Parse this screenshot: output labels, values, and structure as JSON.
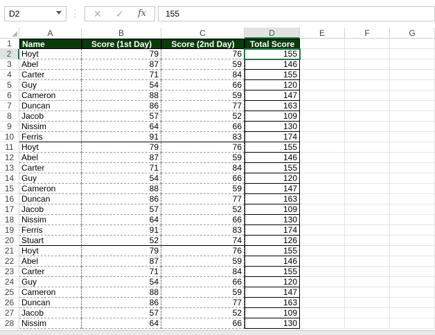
{
  "formula_bar": {
    "name_box": "D2",
    "value": "155",
    "cancel_icon": "✕",
    "enter_icon": "✓",
    "fx_icon": "fx"
  },
  "columns": [
    "A",
    "B",
    "C",
    "D",
    "E",
    "F",
    "G"
  ],
  "selected_column": "D",
  "selected_row": 2,
  "headers": [
    "Name",
    "Score (1st Day)",
    "Score (2nd Day)",
    "Total Score"
  ],
  "rows": [
    {
      "r": 2,
      "name": "Hoyt",
      "s1": "79",
      "s2": "76",
      "total": "155"
    },
    {
      "r": 3,
      "name": "Abel",
      "s1": "87",
      "s2": "59",
      "total": "146"
    },
    {
      "r": 4,
      "name": "Carter",
      "s1": "71",
      "s2": "84",
      "total": "155"
    },
    {
      "r": 5,
      "name": "Guy",
      "s1": "54",
      "s2": "66",
      "total": "120"
    },
    {
      "r": 6,
      "name": "Cameron",
      "s1": "88",
      "s2": "59",
      "total": "147"
    },
    {
      "r": 7,
      "name": "Duncan",
      "s1": "86",
      "s2": "77",
      "total": "163"
    },
    {
      "r": 8,
      "name": "Jacob",
      "s1": "57",
      "s2": "52",
      "total": "109"
    },
    {
      "r": 9,
      "name": "Nissim",
      "s1": "64",
      "s2": "66",
      "total": "130"
    },
    {
      "r": 10,
      "name": "Ferris",
      "s1": "91",
      "s2": "83",
      "total": "174"
    },
    {
      "r": 11,
      "name": "Hoyt",
      "s1": "79",
      "s2": "76",
      "total": "155"
    },
    {
      "r": 12,
      "name": "Abel",
      "s1": "87",
      "s2": "59",
      "total": "146"
    },
    {
      "r": 13,
      "name": "Carter",
      "s1": "71",
      "s2": "84",
      "total": "155"
    },
    {
      "r": 14,
      "name": "Guy",
      "s1": "54",
      "s2": "66",
      "total": "120"
    },
    {
      "r": 15,
      "name": "Cameron",
      "s1": "88",
      "s2": "59",
      "total": "147"
    },
    {
      "r": 16,
      "name": "Duncan",
      "s1": "86",
      "s2": "77",
      "total": "163"
    },
    {
      "r": 17,
      "name": "Jacob",
      "s1": "57",
      "s2": "52",
      "total": "109"
    },
    {
      "r": 18,
      "name": "Nissim",
      "s1": "64",
      "s2": "66",
      "total": "130"
    },
    {
      "r": 19,
      "name": "Ferris",
      "s1": "91",
      "s2": "83",
      "total": "174"
    },
    {
      "r": 20,
      "name": "Stuart",
      "s1": "52",
      "s2": "74",
      "total": "126"
    },
    {
      "r": 21,
      "name": "Hoyt",
      "s1": "79",
      "s2": "76",
      "total": "155"
    },
    {
      "r": 22,
      "name": "Abel",
      "s1": "87",
      "s2": "59",
      "total": "146"
    },
    {
      "r": 23,
      "name": "Carter",
      "s1": "71",
      "s2": "84",
      "total": "155"
    },
    {
      "r": 24,
      "name": "Guy",
      "s1": "54",
      "s2": "66",
      "total": "120"
    },
    {
      "r": 25,
      "name": "Cameron",
      "s1": "88",
      "s2": "59",
      "total": "147"
    },
    {
      "r": 26,
      "name": "Duncan",
      "s1": "86",
      "s2": "77",
      "total": "163"
    },
    {
      "r": 27,
      "name": "Jacob",
      "s1": "57",
      "s2": "52",
      "total": "109"
    },
    {
      "r": 28,
      "name": "Nissim",
      "s1": "64",
      "s2": "66",
      "total": "130"
    }
  ],
  "colors": {
    "header_fill": "#0b3b0b",
    "selection_accent": "#217346"
  }
}
